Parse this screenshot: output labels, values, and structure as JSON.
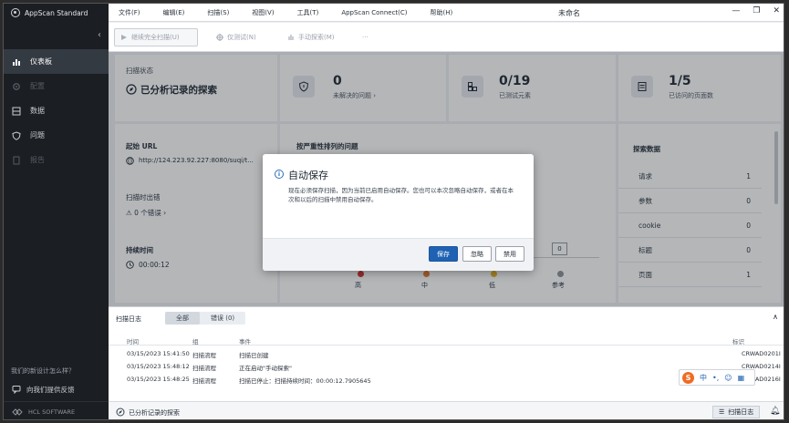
{
  "app": {
    "brand": "AppScan Standard",
    "doc_title": "未命名"
  },
  "menu": [
    "文件(F)",
    "编辑(E)",
    "扫描(S)",
    "视图(V)",
    "工具(T)",
    "AppScan Connect(C)",
    "帮助(H)"
  ],
  "window": {
    "minimize": "—",
    "restore": "❐",
    "close": "✕"
  },
  "toolbar": {
    "full_scan": "继续完全扫描(U)",
    "test": "仅测试(N)",
    "manual": "手动探索(M)",
    "more": "···"
  },
  "sidebar": {
    "collapse": "‹",
    "items": [
      {
        "label": "仪表板",
        "icon": "dashboard-icon",
        "state": "active"
      },
      {
        "label": "配置",
        "icon": "gear-icon",
        "state": "disabled"
      },
      {
        "label": "数据",
        "icon": "data-icon",
        "state": "normal"
      },
      {
        "label": "问题",
        "icon": "shield-icon",
        "state": "normal"
      },
      {
        "label": "报告",
        "icon": "report-icon",
        "state": "disabled"
      }
    ],
    "survey": "我们的新设计怎么样？",
    "feedback": "向我们提供反馈",
    "vendor": "HCL SOFTWARE"
  },
  "dashboard": {
    "scan_status_label": "扫描状态",
    "scan_status_value": "已分析记录的探索",
    "issues_value": "0",
    "issues_label": "未解决的问题",
    "tested_value": "0/19",
    "tested_label": "已测试元素",
    "pages_value": "1/5",
    "pages_label": "已访问的页面数",
    "start_url_label": "起始 URL",
    "start_url_value": "http://124.223.92.227:8080/suqi/t...",
    "scan_errors_label": "扫描时出错",
    "scan_errors_value": "0 个错误",
    "duration_label": "持续时间",
    "duration_value": "00:00:12",
    "severity_title": "按严重性排列的问题",
    "severity_levels": [
      "高",
      "中",
      "低",
      "参考"
    ],
    "severity_box_value": "0",
    "explore_title": "探索数据",
    "explore_rows": [
      {
        "label": "请求",
        "value": "1"
      },
      {
        "label": "参数",
        "value": "0"
      },
      {
        "label": "cookie",
        "value": "0"
      },
      {
        "label": "标题",
        "value": "0"
      },
      {
        "label": "页面",
        "value": "1"
      }
    ]
  },
  "log": {
    "title": "扫描日志",
    "tab_all": "全部",
    "tab_errors": "错误 (0)",
    "collapse": "∧",
    "headers": {
      "time": "时间",
      "group": "组",
      "event": "事件",
      "id": "标识"
    },
    "rows": [
      {
        "time": "03/15/2023 15:41:50",
        "group": "扫描流程",
        "event": "扫描已创建",
        "id": "CRWAD0201I"
      },
      {
        "time": "03/15/2023 15:48:12",
        "group": "扫描流程",
        "event": "正在启动\"手动探索\"",
        "id": "CRWAD0214I"
      },
      {
        "time": "03/15/2023 15:48:25",
        "group": "扫描流程",
        "event": "扫描已停止：扫描持续时间：00:00:12.7905645",
        "id": "CRWAD0216I"
      }
    ]
  },
  "status_bar": {
    "text": "已分析记录的探索",
    "log_button": "扫描日志"
  },
  "modal": {
    "title": "自动保存",
    "body": "现在必须保存扫描，因为当前已启用自动保存。您也可以本次忽略自动保存，或者在本次和以后的扫描中禁用自动保存。",
    "save": "保存",
    "ignore": "忽略",
    "disable": "禁用"
  },
  "ime": {
    "zh": "中",
    "punct": "•,",
    "emoji": "☺"
  },
  "colors": {
    "primary": "#1f62b3",
    "sidebar": "#1b1e23",
    "high": "#d62c2c",
    "medium": "#e8772a",
    "low": "#e6b31e",
    "info": "#8a9099"
  }
}
